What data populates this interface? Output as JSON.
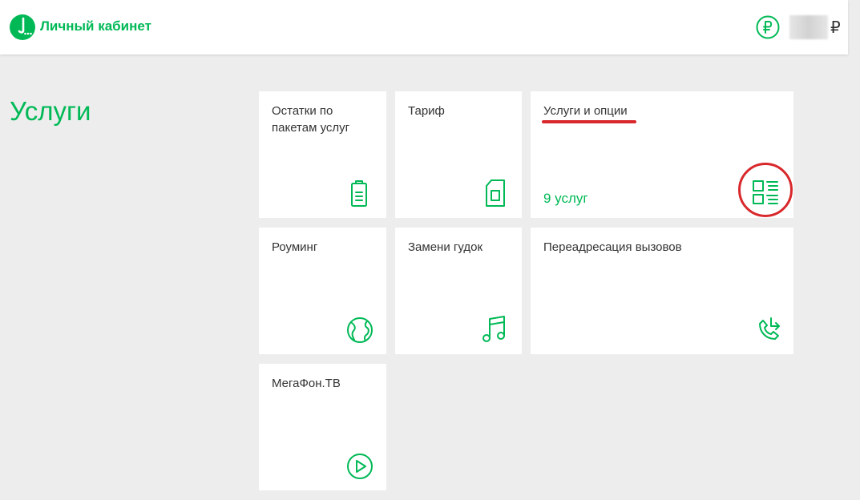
{
  "header": {
    "brand_title": "Личный кабинет",
    "currency_symbol": "₽"
  },
  "page": {
    "title": "Услуги"
  },
  "tiles": [
    {
      "label": "Остатки по пакетам услуг",
      "icon": "battery-icon"
    },
    {
      "label": "Тариф",
      "icon": "sim-card-icon"
    },
    {
      "label": "Услуги и опции",
      "count": "9 услуг",
      "icon": "services-list-icon"
    },
    {
      "label": "Роуминг",
      "icon": "globe-icon"
    },
    {
      "label": "Замени гудок",
      "icon": "music-note-icon"
    },
    {
      "label": "Переадресация вызовов",
      "icon": "call-forward-icon"
    },
    {
      "label": "МегаФон.ТВ",
      "icon": "play-icon"
    }
  ],
  "colors": {
    "brand": "#00b956",
    "background": "#ededed",
    "annotation": "#d9282c",
    "text": "#333333"
  }
}
